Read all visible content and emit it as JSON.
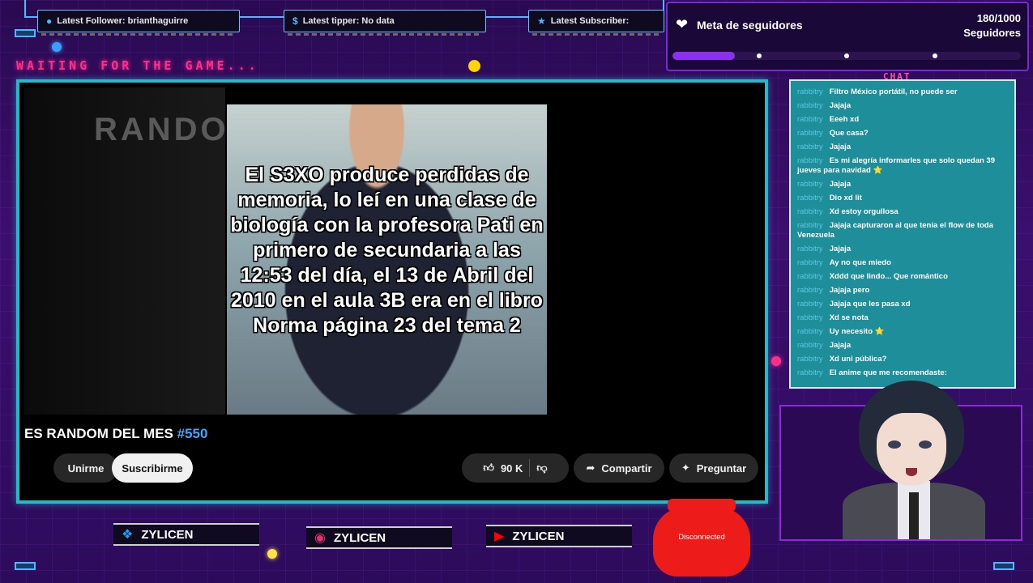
{
  "alerts": {
    "follower": "Latest Follower: brianthaguirre",
    "tipper": "Latest tipper: No data",
    "subscriber": "Latest Subscriber:"
  },
  "waiting_text": "WAITING FOR THE GAME...",
  "goal": {
    "title": "Meta de seguidores",
    "count": "180/1000",
    "unit": "Seguidores",
    "progress": 0.18
  },
  "video": {
    "watermark": "RANDOM",
    "meme_caption": "El S3XO produce perdidas de memoria, lo leí en una clase de biología con la profesora Pati en primero de secundaria a las 12:53 del día, el 13 de Abril del 2010 en el aula 3B era en el libro Norma página 23 del tema 2",
    "meme_brand": "Norma",
    "title_prefix": "ES RANDOM DEL MES",
    "title_number": "#550",
    "join_label": "Unirme",
    "subscribe_label": "Suscribirme",
    "likes": "90 K",
    "share_label": "Compartir",
    "ask_label": "Preguntar"
  },
  "chat": {
    "label": "CHAT",
    "messages": [
      {
        "user": "rabbitry",
        "text": "Filtro México portátil, no puede ser"
      },
      {
        "user": "rabbitry",
        "text": "Jajaja"
      },
      {
        "user": "rabbitry",
        "text": "Eeeh xd"
      },
      {
        "user": "rabbitry",
        "text": "Que casa?"
      },
      {
        "user": "rabbitry",
        "text": "Jajaja"
      },
      {
        "user": "rabbitry",
        "text": "Es mi alegría informarles que solo quedan 39 jueves para navidad ⭐"
      },
      {
        "user": "rabbitry",
        "text": "Jajaja"
      },
      {
        "user": "rabbitry",
        "text": "Dio xd lit"
      },
      {
        "user": "rabbitry",
        "text": "Xd estoy orgullosa"
      },
      {
        "user": "rabbitry",
        "text": "Jajaja capturaron al que tenía el flow de toda Venezuela"
      },
      {
        "user": "rabbitry",
        "text": "Jajaja"
      },
      {
        "user": "rabbitry",
        "text": "Ay no que miedo"
      },
      {
        "user": "rabbitry",
        "text": "Xddd que lindo... Que romántico"
      },
      {
        "user": "rabbitry",
        "text": "Jajaja pero"
      },
      {
        "user": "rabbitry",
        "text": "Jajaja que les pasa xd"
      },
      {
        "user": "rabbitry",
        "text": "Xd se nota"
      },
      {
        "user": "rabbitry",
        "text": "Uy necesito ⭐"
      },
      {
        "user": "rabbitry",
        "text": "Jajaja"
      },
      {
        "user": "rabbitry",
        "text": "Xd uni pública?"
      },
      {
        "user": "rabbitry",
        "text": "El anime que me recomendaste:"
      }
    ]
  },
  "socials": {
    "twitter": "ZYLICEN",
    "instagram": "ZYLICEN",
    "youtube": "ZYLICEN"
  },
  "controller_status": "Disconnected",
  "colors": {
    "accent_cyan": "#27b8c8",
    "accent_pink": "#ff2e8a",
    "accent_purple": "#8d2ff0",
    "link_blue": "#3ea6ff"
  },
  "icons": {
    "follower": "user-icon",
    "tipper": "dollar-icon",
    "subscriber": "star-icon",
    "goal": "heart-icon",
    "like": "thumbs-up-icon",
    "dislike": "thumbs-down-icon",
    "share": "share-icon",
    "ask": "sparkle-icon",
    "twitter": "twitter-icon",
    "instagram": "instagram-icon",
    "youtube": "youtube-icon"
  }
}
